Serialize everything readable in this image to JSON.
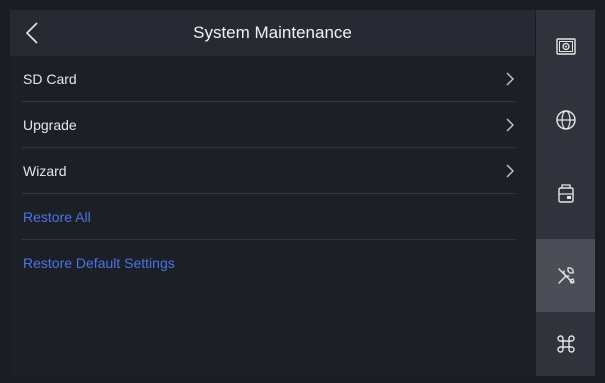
{
  "header": {
    "title": "System Maintenance",
    "back_icon": "chevron-left-icon"
  },
  "menu": {
    "items": [
      {
        "label": "SD Card",
        "has_arrow": true,
        "color": "#e6e6e6"
      },
      {
        "label": "Upgrade",
        "has_arrow": true,
        "color": "#e6e6e6"
      },
      {
        "label": "Wizard",
        "has_arrow": true,
        "color": "#e6e6e6"
      },
      {
        "label": "Restore All",
        "has_arrow": false,
        "color": "#4a74e6"
      },
      {
        "label": "Restore Default Settings",
        "has_arrow": false,
        "color": "#4a74e6"
      }
    ]
  },
  "sidebar": {
    "items": [
      {
        "icon": "camera-icon",
        "active": false
      },
      {
        "icon": "globe-icon",
        "active": false
      },
      {
        "icon": "device-icon",
        "active": false
      },
      {
        "icon": "maintenance-tools-icon",
        "active": true
      },
      {
        "icon": "command-icon",
        "active": false
      }
    ]
  },
  "colors": {
    "background": "#1d1f27",
    "header": "#272a33",
    "sidebar": "#30333b",
    "sidebar_active": "#4b4e57",
    "accent_blue": "#4a74e6"
  }
}
